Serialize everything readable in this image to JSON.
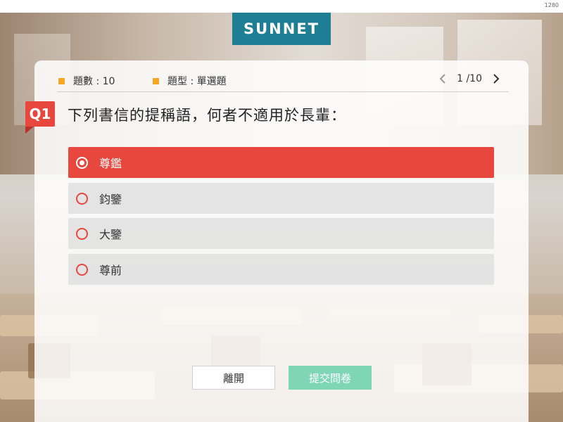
{
  "topbar": {
    "corner_text": "1280"
  },
  "logo": {
    "text": "SUNNET"
  },
  "info": {
    "count_label": "題數 : 10",
    "type_label": "題型 : 單選題"
  },
  "pager": {
    "text": "1 /10"
  },
  "question": {
    "badge": "Q1",
    "text": "下列書信的提稱語，何者不適用於長輩："
  },
  "options": [
    {
      "label": "尊鑑",
      "selected": true
    },
    {
      "label": "鈞鑒",
      "selected": false
    },
    {
      "label": "大鑒",
      "selected": false
    },
    {
      "label": "尊前",
      "selected": false
    }
  ],
  "buttons": {
    "leave": "離開",
    "submit": "提交問卷"
  },
  "colors": {
    "accent": "#e8473e",
    "logo_bg": "#1e7f94",
    "submit_bg": "#7fd6b6",
    "info_square": "#f5a623"
  }
}
